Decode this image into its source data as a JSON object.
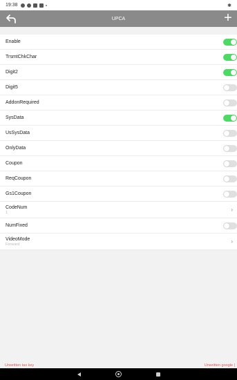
{
  "status_bar": {
    "time": "19:38"
  },
  "app_bar": {
    "title": "UPCA",
    "add_label": "+"
  },
  "settings": [
    {
      "id": "enable",
      "label": "Enable",
      "kind": "toggle",
      "on": true
    },
    {
      "id": "trsmtchkchar",
      "label": "TrsmtChkChar",
      "kind": "toggle",
      "on": true
    },
    {
      "id": "digit2",
      "label": "Digit2",
      "kind": "toggle",
      "on": true
    },
    {
      "id": "digit5",
      "label": "Digit5",
      "kind": "toggle",
      "on": false
    },
    {
      "id": "addonrequired",
      "label": "AddonRequired",
      "kind": "toggle",
      "on": false
    },
    {
      "id": "sysdata",
      "label": "SysData",
      "kind": "toggle",
      "on": true
    },
    {
      "id": "ussysdata",
      "label": "UsSysData",
      "kind": "toggle",
      "on": false
    },
    {
      "id": "onlydata",
      "label": "OnlyData",
      "kind": "toggle",
      "on": false
    },
    {
      "id": "coupon",
      "label": "Coupon",
      "kind": "toggle",
      "on": false
    },
    {
      "id": "reqcoupon",
      "label": "ReqCoupon",
      "kind": "toggle",
      "on": false
    },
    {
      "id": "gs1coupon",
      "label": "Gs1Coupon",
      "kind": "toggle",
      "on": false
    },
    {
      "id": "codenum",
      "label": "CodeNum",
      "kind": "select",
      "value": "1"
    },
    {
      "id": "numfixed",
      "label": "NumFixed",
      "kind": "toggle",
      "on": false
    },
    {
      "id": "videomode",
      "label": "VideoMode",
      "kind": "select",
      "value": "Forward"
    }
  ],
  "footer": {
    "left": "Unwritten tax key",
    "right": "Unwritten google |"
  },
  "colors": {
    "toggle_on": "#4cd964",
    "toggle_off": "#e0e0e0",
    "app_bar": "#8a8a8a",
    "footer_text": "#e05a5a"
  },
  "icons": {
    "back": "back-arrow-icon",
    "add": "plus-icon",
    "chevron": "chevron-right-icon"
  }
}
